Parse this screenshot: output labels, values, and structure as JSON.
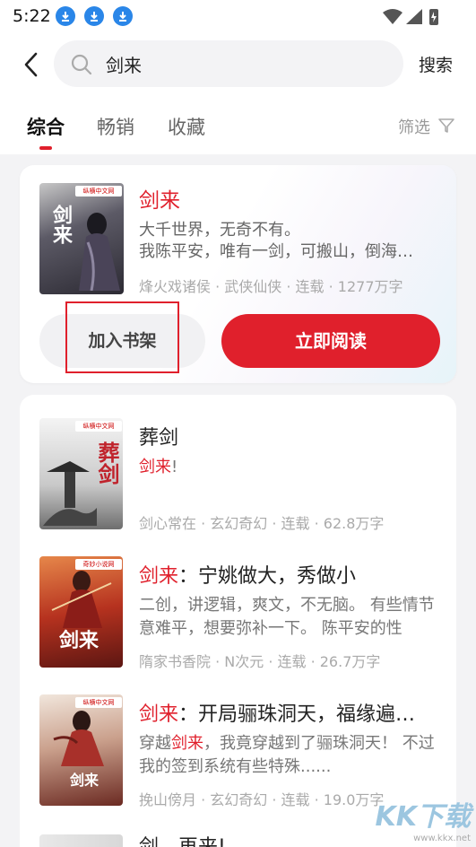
{
  "status": {
    "time": "5:22"
  },
  "header": {
    "search_value": "剑来",
    "search_button": "搜索"
  },
  "tabs": {
    "items": [
      "综合",
      "畅销",
      "收藏"
    ],
    "filter": "筛选"
  },
  "top_result": {
    "cover_tag": "纵横中文网",
    "cover_title": "剑来",
    "title": "剑来",
    "desc_line1": "大千世界，无奇不有。",
    "desc_line2": "我陈平安，唯有一剑，可搬山，倒海…",
    "meta": "烽火戏诸侯 · 武侠仙侠 · 连载 · 1277万字",
    "add_shelf": "加入书架",
    "read_now": "立即阅读"
  },
  "books": [
    {
      "cover_tag": "纵横中文网",
      "cover_title": "葬剑",
      "title_plain": "葬剑",
      "title_red": "",
      "desc_red": "剑来",
      "desc_plain": "!",
      "meta": "剑心常在 · 玄幻奇幻 · 连载 · 62.8万字"
    },
    {
      "cover_tag": "奇妙小说网",
      "cover_title": "剑来",
      "title_red": "剑来",
      "title_plain": "：宁姚做大，秀做小",
      "desc_red": "",
      "desc_plain": "二创，讲逻辑，爽文，不无脑。 有些情节意难平，想要弥补一下。 陈平安的性",
      "meta": "隋家书香院 · N次元 · 连载 · 26.7万字"
    },
    {
      "cover_tag": "纵横中文网",
      "cover_title": "剑来",
      "title_red": "剑来",
      "title_plain": "：开局骊珠洞天，福缘遍…",
      "desc_pre": "穿越",
      "desc_red": "剑来",
      "desc_plain": "，我竟穿越到了骊珠洞天！ 不过我的签到系统有些特殊......",
      "meta": "挽山傍月 · 玄幻奇幻 · 连载 · 19.0万字"
    },
    {
      "title_plain": "剑，再来!"
    }
  ],
  "watermark": {
    "logo": "KK下载",
    "url": "www.kkx.net"
  },
  "colors": {
    "accent": "#e0202c",
    "download_icon": "#2a86e8"
  }
}
